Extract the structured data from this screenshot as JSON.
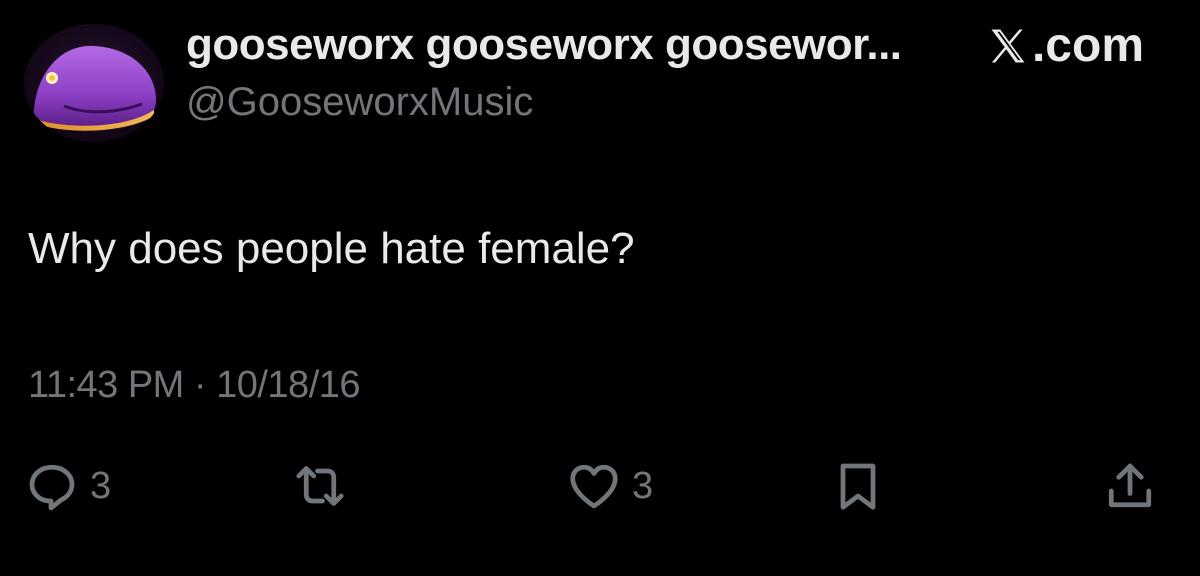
{
  "header": {
    "display_name": "gooseworx gooseworx goosewor...",
    "handle": "@GooseworxMusic",
    "brand_suffix": ".com",
    "brand_icon": "x-logo-icon",
    "avatar_icon": "purple-whale-avatar"
  },
  "tweet": {
    "text": "Why does people hate female?",
    "timestamp": "11:43 PM · 10/18/16"
  },
  "actions": {
    "reply": {
      "icon": "reply-icon",
      "count": "3"
    },
    "retweet": {
      "icon": "retweet-icon"
    },
    "like": {
      "icon": "heart-icon",
      "count": "3"
    },
    "bookmark": {
      "icon": "bookmark-icon"
    },
    "share": {
      "icon": "share-icon"
    }
  },
  "colors": {
    "background": "#000000",
    "primary_text": "#e7e9ea",
    "secondary_text": "#71767b",
    "avatar_purple": "#9b4fd6"
  }
}
